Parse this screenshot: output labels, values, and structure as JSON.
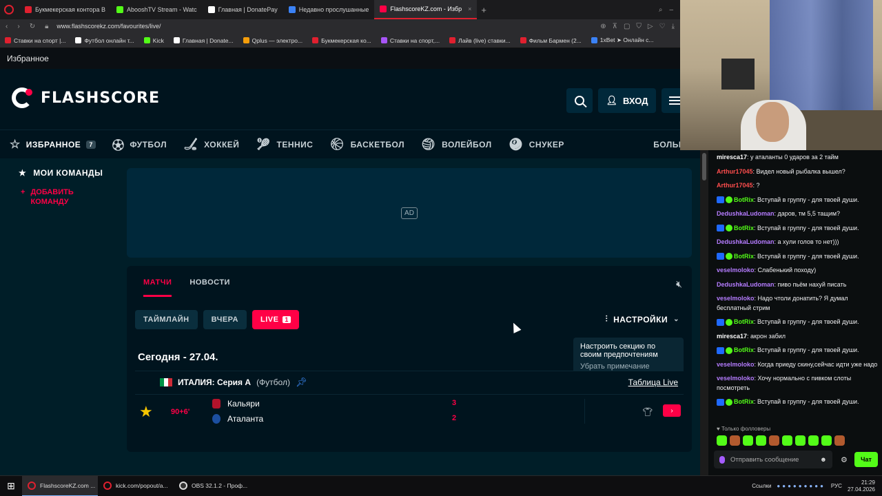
{
  "browser": {
    "tabs": [
      {
        "label": "Букмекерская контора В",
        "color": "#e0202f"
      },
      {
        "label": "AbooshTV Stream - Watc",
        "color": "#53fc18"
      },
      {
        "label": "Главная | DonatePay",
        "color": "#ffffff"
      },
      {
        "label": "Недавно прослушанные",
        "color": "#3b82f6"
      },
      {
        "label": "FlashscoreKZ.com - Избр",
        "color": "#ff0046",
        "active": true
      }
    ],
    "url": "www.flashscorekz.com/favourites/live/",
    "bookmarks": [
      {
        "label": "Ставки на спорт |...",
        "color": "#e0202f"
      },
      {
        "label": "Футбол онлайн т...",
        "color": "#ffffff"
      },
      {
        "label": "Kick",
        "color": "#53fc18"
      },
      {
        "label": "Главная | Donate...",
        "color": "#ffffff"
      },
      {
        "label": "Qplus — электро...",
        "color": "#f59e0b"
      },
      {
        "label": "Букмекерская ко...",
        "color": "#e0202f"
      },
      {
        "label": "Ставки на спорт,...",
        "color": "#a855f7"
      },
      {
        "label": "Лайв (live) ставки...",
        "color": "#e0202f"
      },
      {
        "label": "Фильм Бармен (2...",
        "color": "#e0202f"
      },
      {
        "label": "1xBet ➤ Онлайн с...",
        "color": "#3b82f6"
      }
    ]
  },
  "site": {
    "favbar_title": "Избранное",
    "logo_text": "FLASHSCORE",
    "login_label": "ВХОД",
    "sports": [
      {
        "label": "ИЗБРАННОЕ",
        "icon": "☆",
        "badge": "7",
        "active": true
      },
      {
        "label": "ФУТБОЛ",
        "icon": "⚽"
      },
      {
        "label": "ХОККЕЙ",
        "icon": "🏒"
      },
      {
        "label": "ТЕННИС",
        "icon": "🎾"
      },
      {
        "label": "БАСКЕТБОЛ",
        "icon": "🏀"
      },
      {
        "label": "ВОЛЕЙБОЛ",
        "icon": "🏐"
      },
      {
        "label": "СНУКЕР",
        "icon": "🎱"
      },
      {
        "label": "БОЛЬШЕ",
        "icon": ""
      }
    ],
    "sidebar": {
      "title": "МОИ КОМАНДЫ",
      "add": "ДОБАВИТЬ КОМАНДУ"
    },
    "ad_label": "AD",
    "panel": {
      "tab_matches": "МАТЧИ",
      "tab_news": "НОВОСТИ",
      "filter_timeline": "ТАЙМЛАЙН",
      "filter_yesterday": "ВЧЕРА",
      "filter_live": "LIVE",
      "filter_live_count": "1",
      "settings": "НАСТРОЙКИ",
      "tooltip_text": "Настроить секцию по своим предпочтениям",
      "tooltip_dismiss": "Убрать примечание",
      "date": "Сегодня - 27.04.",
      "league_name": "ИТАЛИЯ: Серия А",
      "league_sport": "(Футбол)",
      "league_table": "Таблица Live",
      "match": {
        "time": "90+6'",
        "home": "Кальяри",
        "away": "Аталанта",
        "home_score": "3",
        "away_score": "2"
      }
    }
  },
  "chat": {
    "messages": [
      {
        "user": "mirescа17",
        "color": "#ffffff",
        "text": ": у аталанты 0 ударов за 2 тайм"
      },
      {
        "user": "Arthur17045",
        "color": "#ff4d4d",
        "text": ": Видел новый рыбалка вышел?"
      },
      {
        "user": "Arthur17045",
        "color": "#ff4d4d",
        "text": ": ?"
      },
      {
        "user": "BotRix",
        "color": "#53fc18",
        "bot": true,
        "text": ": Вступай в группу - для твоей души."
      },
      {
        "user": "DedushkaLudoman",
        "color": "#b57cff",
        "text": ": даров, тм 5,5 тащим?"
      },
      {
        "user": "BotRix",
        "color": "#53fc18",
        "bot": true,
        "text": ": Вступай в группу - для твоей души."
      },
      {
        "user": "DedushkaLudoman",
        "color": "#b57cff",
        "text": ": а хули голов то нет)))"
      },
      {
        "user": "BotRix",
        "color": "#53fc18",
        "bot": true,
        "text": ": Вступай в группу - для твоей души."
      },
      {
        "user": "veselmoloko",
        "color": "#b57cff",
        "text": ": Слабенький походу)"
      },
      {
        "user": "DedushkaLudoman",
        "color": "#b57cff",
        "text": ": пиво пьём нахуй писать"
      },
      {
        "user": "veselmoloko",
        "color": "#b57cff",
        "text": ": Надо чтоли донатить? Я думал бесплатный стрим"
      },
      {
        "user": "BotRix",
        "color": "#53fc18",
        "bot": true,
        "text": ": Вступай в группу - для твоей души."
      },
      {
        "user": "mirescа17",
        "color": "#ffffff",
        "text": ": акрон забил"
      },
      {
        "user": "BotRix",
        "color": "#53fc18",
        "bot": true,
        "text": ": Вступай в группу - для твоей души."
      },
      {
        "user": "veselmoloko",
        "color": "#b57cff",
        "text": ": Когда приеду скину,сейчас идти уже надо"
      },
      {
        "user": "veselmoloko",
        "color": "#b57cff",
        "text": ": Хочу нормально с пивком слоты посмотреть"
      },
      {
        "user": "BotRix",
        "color": "#53fc18",
        "bot": true,
        "text": ": Вступай в группу - для твоей души."
      }
    ],
    "followers_only": "Только фолловеры",
    "input_placeholder": "Отправить сообщение",
    "send_label": "Чат"
  },
  "taskbar": {
    "apps": [
      {
        "label": "FlashscoreKZ.com ...",
        "active": true
      },
      {
        "label": "kick.com/popout/a..."
      },
      {
        "label": "OBS 32.1.2 - Проф..."
      }
    ],
    "links_label": "Ссылки",
    "lang": "РУС",
    "time": "21:29",
    "date": "27.04.2026"
  }
}
